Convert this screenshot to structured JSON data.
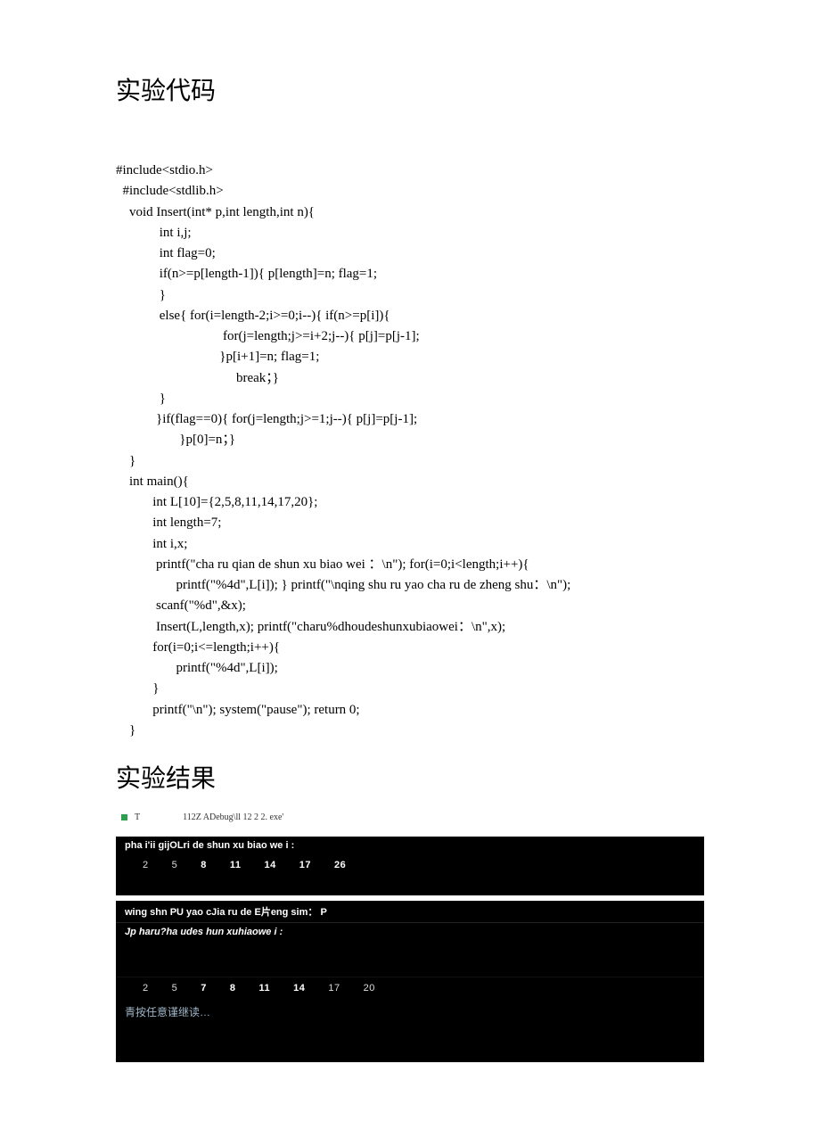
{
  "headings": {
    "code": "实验代码",
    "result": "实验结果"
  },
  "code": "#include<stdio.h>\n  #include<stdlib.h>\n    void Insert(int* p,int length,int n){\n             int i,j;\n             int flag=0;\n             if(n>=p[length-1]){ p[length]=n; flag=1;\n             }\n             else{ for(i=length-2;i>=0;i--){ if(n>=p[i]){\n                                for(j=length;j>=i+2;j--){ p[j]=p[j-1];\n                               }p[i+1]=n; flag=1;\n                                    break；}\n             }\n            }if(flag==0){ for(j=length;j>=1;j--){ p[j]=p[j-1];\n                   }p[0]=n；}\n    }\n    int main(){\n           int L[10]={2,5,8,11,14,17,20};\n           int length=7;\n           int i,x;\n            printf(\"cha ru qian de shun xu biao wei ：\\n\"); for(i=0;i<length;i++){\n                  printf(\"%4d\",L[i]); } printf(\"\\nqing shu ru yao cha ru de zheng shu：\\n\");\n            scanf(\"%d\",&x);\n            Insert(L,length,x); printf(\"charu%dhoudeshunxubiaowei：\\n\",x);\n           for(i=0;i<=length;i++){\n                  printf(\"%4d\",L[i]);\n           }\n           printf(\"\\n\"); system(\"pause\"); return 0;\n    }",
  "console": {
    "titlebar_icon_label": "T",
    "titlebar_path": "112Z ADebug\\ll 12 2 2. exe'",
    "line1": "pha i'ii gijOLri de shun xu biao we i :",
    "row1": [
      "2",
      "5",
      "8",
      "11",
      "14",
      "17",
      "26"
    ],
    "line2": "wing shn PU yao cJia ru de E片eng sim：  P",
    "line3": "Jp haru?ha udes hun xuhiaowe i :",
    "row2": [
      "2",
      "5",
      "7",
      "8",
      "11",
      "14",
      "17",
      "20"
    ],
    "press": "青按任意谨继读…"
  }
}
